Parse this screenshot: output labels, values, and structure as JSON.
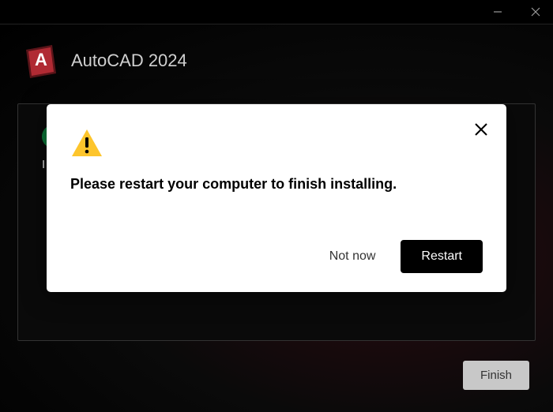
{
  "header": {
    "title": "AutoCAD 2024",
    "logo_letter": "A"
  },
  "content": {
    "status_text": "I"
  },
  "footer": {
    "finish_label": "Finish"
  },
  "modal": {
    "message": "Please restart your computer to finish installing.",
    "not_now_label": "Not now",
    "restart_label": "Restart"
  }
}
